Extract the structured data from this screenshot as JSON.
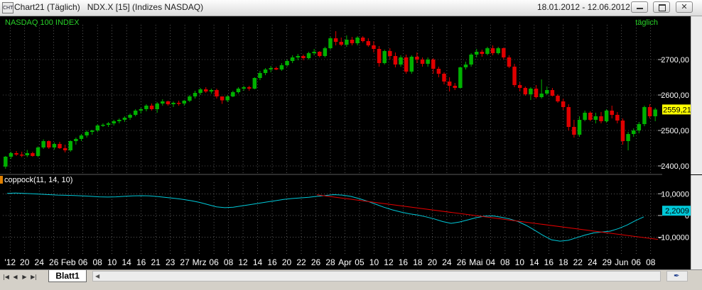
{
  "window": {
    "title": "Chart21 (Täglich)   NDX.X [15] (Indizes NASDAQ)",
    "icon_label": "CHT",
    "date_range": "18.01.2012 - 12.06.2012",
    "buttons": [
      "minimize-icon",
      "restore-icon",
      "close-icon"
    ]
  },
  "sheet": {
    "tab_label": "Blatt1",
    "nav_icons": [
      "first-icon",
      "prev-icon",
      "next-icon",
      "last-icon"
    ]
  },
  "chart_data": [
    {
      "type": "candlestick",
      "title": "NASDAQ 100 INDEX",
      "subtitle": "täglich",
      "ylim": [
        2380,
        2790
      ],
      "y_ticks": [
        2400,
        2500,
        2600,
        2700
      ],
      "y_tick_labels": [
        "2400,00",
        "2500,00",
        "2600,00",
        "2700,00"
      ],
      "last_value_label": "2559,21",
      "last_value": 2559.21,
      "grid": true,
      "colors": {
        "up": "#00b000",
        "down": "#e00000",
        "background": "#000000",
        "grid": "#8c8c8c",
        "title": "#28d028",
        "last_label_bg": "#ffff00"
      },
      "x_labels": [
        "'12",
        "20",
        "24",
        "26",
        "Feb",
        "06",
        "08",
        "10",
        "14",
        "16",
        "21",
        "23",
        "27",
        "Mrz",
        "06",
        "08",
        "12",
        "14",
        "16",
        "20",
        "22",
        "26",
        "28",
        "Apr",
        "05",
        "10",
        "12",
        "16",
        "18",
        "20",
        "24",
        "26",
        "Mai",
        "04",
        "08",
        "10",
        "14",
        "16",
        "18",
        "22",
        "24",
        "29",
        "Jun",
        "06",
        "08"
      ],
      "candles": [
        [
          2398,
          2428,
          2392,
          2426
        ],
        [
          2426,
          2440,
          2420,
          2436
        ],
        [
          2436,
          2442,
          2428,
          2432
        ],
        [
          2432,
          2440,
          2425,
          2430
        ],
        [
          2430,
          2445,
          2425,
          2436
        ],
        [
          2436,
          2440,
          2426,
          2428
        ],
        [
          2428,
          2455,
          2425,
          2452
        ],
        [
          2452,
          2475,
          2448,
          2470
        ],
        [
          2470,
          2472,
          2448,
          2452
        ],
        [
          2452,
          2466,
          2446,
          2462
        ],
        [
          2462,
          2468,
          2448,
          2450
        ],
        [
          2450,
          2460,
          2438,
          2444
        ],
        [
          2444,
          2472,
          2440,
          2470
        ],
        [
          2470,
          2480,
          2460,
          2476
        ],
        [
          2476,
          2490,
          2470,
          2486
        ],
        [
          2486,
          2500,
          2480,
          2496
        ],
        [
          2496,
          2502,
          2488,
          2500
        ],
        [
          2500,
          2518,
          2496,
          2514
        ],
        [
          2514,
          2520,
          2510,
          2516
        ],
        [
          2516,
          2524,
          2510,
          2520
        ],
        [
          2520,
          2530,
          2514,
          2526
        ],
        [
          2526,
          2534,
          2520,
          2530
        ],
        [
          2530,
          2540,
          2524,
          2536
        ],
        [
          2536,
          2548,
          2530,
          2544
        ],
        [
          2544,
          2560,
          2540,
          2556
        ],
        [
          2556,
          2564,
          2548,
          2560
        ],
        [
          2560,
          2574,
          2554,
          2570
        ],
        [
          2570,
          2576,
          2556,
          2560
        ],
        [
          2560,
          2580,
          2550,
          2576
        ],
        [
          2576,
          2588,
          2570,
          2582
        ],
        [
          2582,
          2584,
          2570,
          2574
        ],
        [
          2574,
          2582,
          2566,
          2578
        ],
        [
          2578,
          2584,
          2570,
          2576
        ],
        [
          2576,
          2586,
          2570,
          2584
        ],
        [
          2584,
          2600,
          2580,
          2596
        ],
        [
          2596,
          2612,
          2590,
          2606
        ],
        [
          2606,
          2620,
          2600,
          2616
        ],
        [
          2616,
          2622,
          2606,
          2610
        ],
        [
          2610,
          2618,
          2604,
          2614
        ],
        [
          2614,
          2618,
          2590,
          2596
        ],
        [
          2596,
          2590,
          2575,
          2585
        ],
        [
          2585,
          2600,
          2580,
          2596
        ],
        [
          2596,
          2612,
          2594,
          2608
        ],
        [
          2608,
          2622,
          2604,
          2618
        ],
        [
          2618,
          2626,
          2612,
          2622
        ],
        [
          2622,
          2626,
          2612,
          2618
        ],
        [
          2618,
          2650,
          2616,
          2648
        ],
        [
          2648,
          2668,
          2642,
          2662
        ],
        [
          2662,
          2676,
          2656,
          2672
        ],
        [
          2672,
          2682,
          2664,
          2676
        ],
        [
          2676,
          2680,
          2670,
          2672
        ],
        [
          2672,
          2690,
          2668,
          2684
        ],
        [
          2684,
          2700,
          2680,
          2696
        ],
        [
          2696,
          2712,
          2690,
          2706
        ],
        [
          2706,
          2716,
          2698,
          2710
        ],
        [
          2710,
          2714,
          2698,
          2704
        ],
        [
          2704,
          2722,
          2700,
          2718
        ],
        [
          2718,
          2730,
          2712,
          2722
        ],
        [
          2722,
          2724,
          2706,
          2710
        ],
        [
          2710,
          2736,
          2706,
          2732
        ],
        [
          2732,
          2764,
          2728,
          2760
        ],
        [
          2760,
          2780,
          2740,
          2750
        ],
        [
          2750,
          2762,
          2738,
          2742
        ],
        [
          2742,
          2768,
          2736,
          2756
        ],
        [
          2756,
          2764,
          2740,
          2746
        ],
        [
          2746,
          2766,
          2740,
          2762
        ],
        [
          2762,
          2766,
          2748,
          2752
        ],
        [
          2752,
          2760,
          2736,
          2740
        ],
        [
          2740,
          2752,
          2720,
          2730
        ],
        [
          2730,
          2738,
          2680,
          2690
        ],
        [
          2690,
          2728,
          2686,
          2724
        ],
        [
          2724,
          2732,
          2700,
          2710
        ],
        [
          2710,
          2720,
          2678,
          2686
        ],
        [
          2686,
          2712,
          2680,
          2706
        ],
        [
          2706,
          2714,
          2660,
          2666
        ],
        [
          2666,
          2712,
          2660,
          2708
        ],
        [
          2708,
          2720,
          2690,
          2700
        ],
        [
          2700,
          2706,
          2680,
          2688
        ],
        [
          2688,
          2706,
          2680,
          2700
        ],
        [
          2700,
          2704,
          2660,
          2674
        ],
        [
          2674,
          2680,
          2650,
          2660
        ],
        [
          2660,
          2664,
          2630,
          2638
        ],
        [
          2638,
          2650,
          2610,
          2626
        ],
        [
          2626,
          2634,
          2614,
          2620
        ],
        [
          2620,
          2680,
          2618,
          2678
        ],
        [
          2678,
          2694,
          2672,
          2686
        ],
        [
          2686,
          2718,
          2680,
          2714
        ],
        [
          2714,
          2730,
          2706,
          2722
        ],
        [
          2722,
          2728,
          2708,
          2716
        ],
        [
          2716,
          2736,
          2712,
          2732
        ],
        [
          2732,
          2740,
          2712,
          2718
        ],
        [
          2718,
          2736,
          2714,
          2732
        ],
        [
          2732,
          2734,
          2700,
          2706
        ],
        [
          2706,
          2712,
          2676,
          2680
        ],
        [
          2680,
          2688,
          2622,
          2628
        ],
        [
          2628,
          2636,
          2610,
          2620
        ],
        [
          2620,
          2624,
          2598,
          2602
        ],
        [
          2602,
          2622,
          2586,
          2618
        ],
        [
          2618,
          2628,
          2590,
          2594
        ],
        [
          2594,
          2644,
          2590,
          2604
        ],
        [
          2604,
          2624,
          2600,
          2614
        ],
        [
          2614,
          2620,
          2596,
          2598
        ],
        [
          2598,
          2602,
          2578,
          2582
        ],
        [
          2582,
          2590,
          2558,
          2566
        ],
        [
          2566,
          2574,
          2500,
          2510
        ],
        [
          2510,
          2530,
          2480,
          2488
        ],
        [
          2488,
          2540,
          2482,
          2530
        ],
        [
          2530,
          2556,
          2526,
          2550
        ],
        [
          2550,
          2554,
          2526,
          2530
        ],
        [
          2530,
          2550,
          2520,
          2540
        ],
        [
          2540,
          2552,
          2520,
          2526
        ],
        [
          2526,
          2560,
          2522,
          2556
        ],
        [
          2556,
          2570,
          2534,
          2544
        ],
        [
          2544,
          2552,
          2520,
          2528
        ],
        [
          2528,
          2534,
          2460,
          2470
        ],
        [
          2470,
          2496,
          2444,
          2490
        ],
        [
          2490,
          2506,
          2482,
          2500
        ],
        [
          2500,
          2524,
          2492,
          2518
        ],
        [
          2518,
          2570,
          2512,
          2566
        ],
        [
          2566,
          2574,
          2534,
          2540
        ],
        [
          2540,
          2564,
          2526,
          2559
        ]
      ]
    },
    {
      "type": "line",
      "title": "coppock(11, 14, 10)",
      "ylim": [
        -16,
        14
      ],
      "y_ticks": [
        10,
        0,
        -10
      ],
      "y_tick_labels": [
        "10,0000",
        "0",
        "-10,0000"
      ],
      "last_value_label": "2,2009",
      "last_value": 2.2009,
      "colors": {
        "line": "#00c8d8",
        "trend": "#e00000",
        "last_label_bg": "#00c8d8"
      },
      "series": [
        {
          "values": [
            10.2,
            10.3,
            10.2,
            10.0,
            9.8,
            9.6,
            9.4,
            9.3,
            9.2,
            9.0,
            8.8,
            8.6,
            8.5,
            8.6,
            8.8,
            9.0,
            9.1,
            9.0,
            8.7,
            8.3,
            7.9,
            7.4,
            6.8,
            6.0,
            5.0,
            4.0,
            3.6,
            3.8,
            4.4,
            5.0,
            5.6,
            6.2,
            6.8,
            7.4,
            7.8,
            8.1,
            8.4,
            8.8,
            9.2,
            9.6,
            9.4,
            8.8,
            7.8,
            6.6,
            5.2,
            3.8,
            2.6,
            1.6,
            0.8,
            0.2,
            -0.6,
            -1.6,
            -2.8,
            -3.6,
            -3.0,
            -2.0,
            -1.0,
            -0.3,
            -0.2,
            -0.8,
            -1.6,
            -2.8,
            -4.6,
            -6.8,
            -9.2,
            -11.2,
            -11.8,
            -11.4,
            -10.2,
            -9.0,
            -8.0,
            -7.6,
            -7.2,
            -6.0,
            -4.4,
            -2.4,
            -0.6
          ]
        },
        {
          "values": [
            9.5,
            -11.0
          ]
        }
      ]
    }
  ]
}
